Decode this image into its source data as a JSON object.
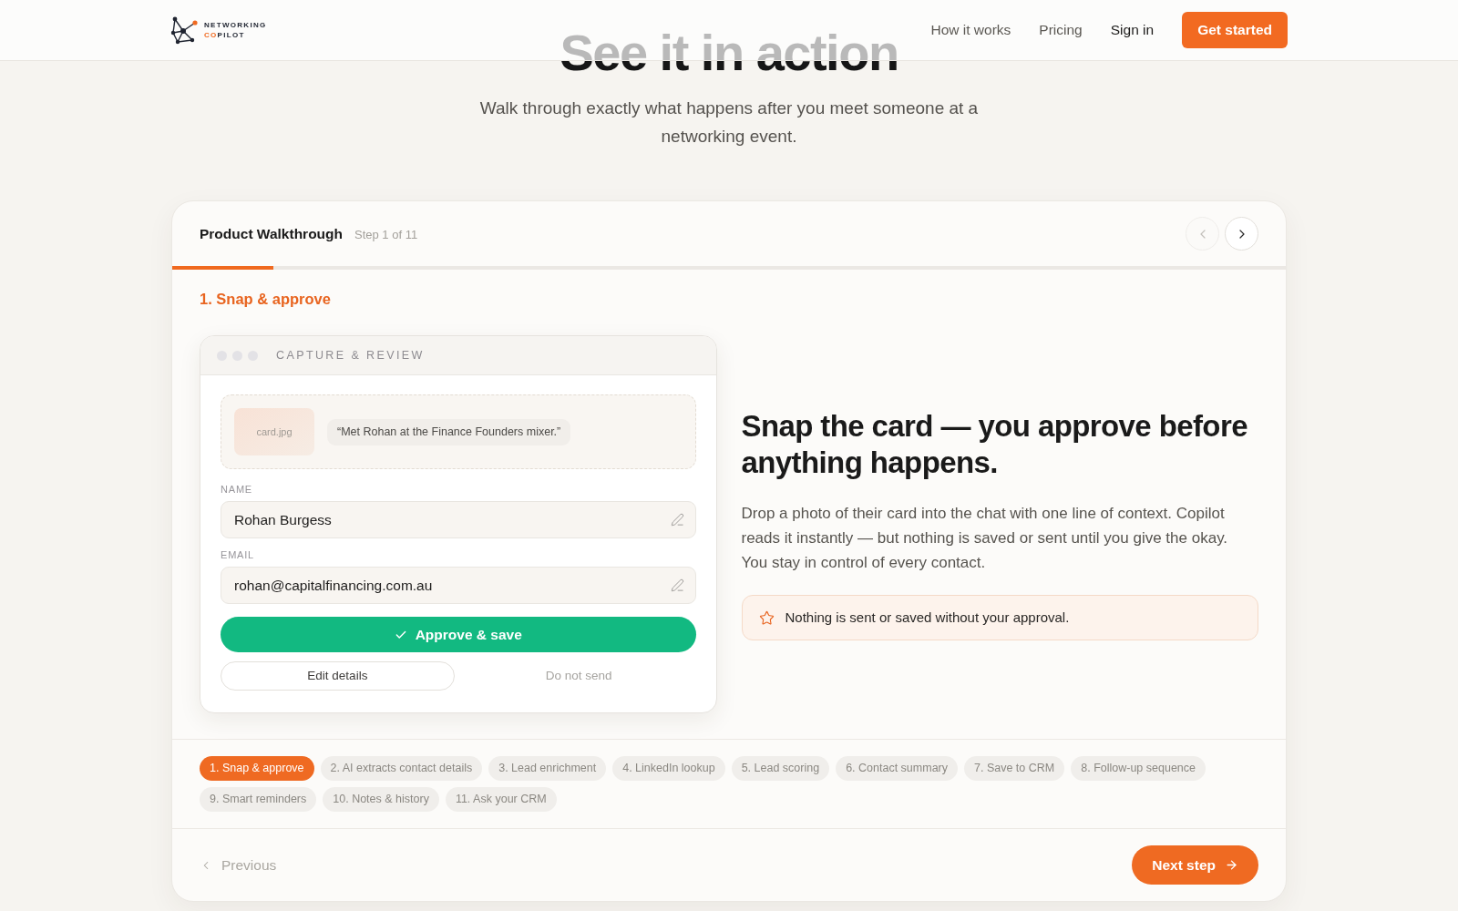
{
  "header": {
    "logo": {
      "line_1": "NETWORKING",
      "line_2_accent": "CO",
      "line_2_rest": "PILOT"
    },
    "nav_links": [
      {
        "label": "How it works",
        "kind": "link"
      },
      {
        "label": "Pricing",
        "kind": "link"
      },
      {
        "label": "Sign in",
        "kind": "account"
      }
    ],
    "cta_button": "Get started"
  },
  "hero": {
    "title": "See it in action",
    "subtitle": "Walk through exactly what happens after you meet someone at a networking event."
  },
  "walkthrough": {
    "title": "Product Walkthrough",
    "step_counter": "Step 1 of 11",
    "prev_button": {
      "disabled": true
    },
    "next_button": {
      "disabled": false
    },
    "progress": {
      "level": 0.0909
    },
    "step_title": "1. Snap & approve",
    "mock_window": {
      "title": "CAPTURE & REVIEW",
      "attachment": {
        "file_name": "card.jpg",
        "message": "“Met Rohan at the Finance Founders mixer.”"
      },
      "fields": [
        {
          "label": "NAME",
          "value": "Rohan Burgess"
        },
        {
          "label": "EMAIL",
          "value": "rohan@capitalfinancing.com.au"
        }
      ],
      "primary_button": "Approve & save",
      "secondary_button": "Edit details",
      "tertiary_button": "Do not send"
    },
    "description": {
      "heading": "Snap the card — you approve before anything happens.",
      "body": "Drop a photo of their card into the chat with one line of context. Copilot reads it instantly — but nothing is saved or sent until you give the okay. You stay in control of every contact.",
      "notice": "Nothing is sent or saved without your approval."
    },
    "steps": [
      {
        "label": "1. Snap & approve",
        "selected": true
      },
      {
        "label": "2. AI extracts contact details",
        "selected": false
      },
      {
        "label": "3. Lead enrichment",
        "selected": false
      },
      {
        "label": "4. LinkedIn lookup",
        "selected": false
      },
      {
        "label": "5. Lead scoring",
        "selected": false
      },
      {
        "label": "6. Contact summary",
        "selected": false
      },
      {
        "label": "7. Save to CRM",
        "selected": false
      },
      {
        "label": "8. Follow-up sequence",
        "selected": false
      },
      {
        "label": "9. Smart reminders",
        "selected": false
      },
      {
        "label": "10. Notes & history",
        "selected": false
      },
      {
        "label": "11. Ask your CRM",
        "selected": false
      }
    ],
    "footer": {
      "previous": {
        "label": "Previous",
        "disabled": true
      },
      "next": {
        "label": "Next step"
      }
    }
  }
}
